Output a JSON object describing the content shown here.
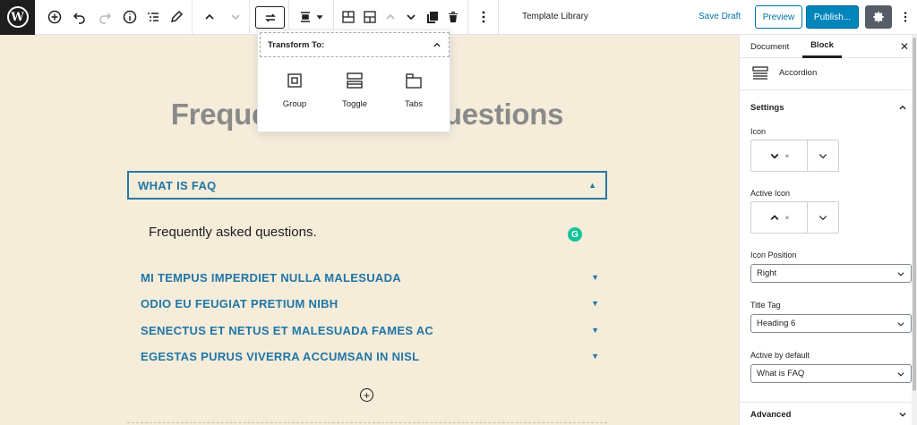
{
  "toolbar": {
    "doc_title": "Template Library",
    "save_draft": "Save Draft",
    "preview": "Preview",
    "publish": "Publish..."
  },
  "editor": {
    "page_title": "Frequently Asked Questions",
    "active_item": {
      "title": "WHAT IS FAQ",
      "body": "Frequently asked questions."
    },
    "items": [
      {
        "title": "MI TEMPUS IMPERDIET NULLA MALESUADA"
      },
      {
        "title": "ODIO EU FEUGIAT PRETIUM NIBH"
      },
      {
        "title": "SENECTUS ET NETUS ET MALESUADA FAMES AC"
      },
      {
        "title": "EGESTAS PURUS VIVERRA ACCUMSAN IN NISL"
      }
    ]
  },
  "transform_popover": {
    "title": "Transform To:",
    "options": [
      {
        "label": "Group",
        "icon": "group-icon"
      },
      {
        "label": "Toggle",
        "icon": "toggle-icon"
      },
      {
        "label": "Tabs",
        "icon": "tabs-icon"
      }
    ]
  },
  "sidebar": {
    "tabs": {
      "document": "Document",
      "block": "Block"
    },
    "block_name": "Accordion",
    "settings": {
      "heading": "Settings",
      "icon_label": "Icon",
      "active_icon_label": "Active Icon",
      "clear_symbol": "×",
      "icon_position_label": "Icon Position",
      "icon_position_value": "Right",
      "title_tag_label": "Title Tag",
      "title_tag_value": "Heading 6",
      "active_default_label": "Active by default",
      "active_default_value": "What is FAQ"
    },
    "advanced": "Advanced"
  },
  "colors": {
    "canvas_bg": "#f5ecda",
    "accent": "#1f76a7",
    "publish": "#0085ba"
  }
}
